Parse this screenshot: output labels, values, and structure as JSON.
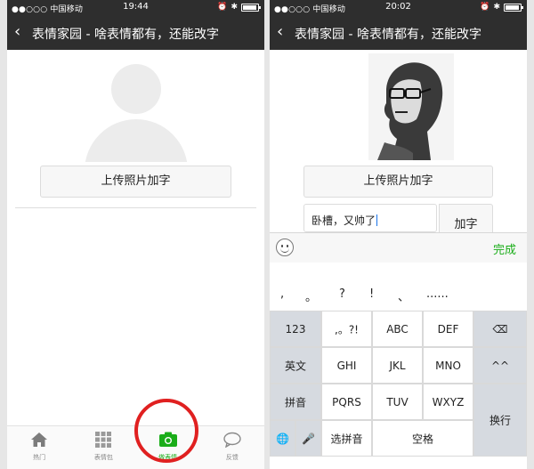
{
  "left_phone": {
    "status": {
      "carrier": "●●○○○ 中国移动",
      "time": "19:44"
    },
    "nav": {
      "back": "‹",
      "title": "表情家园 - 啥表情都有，还能改字"
    },
    "upload_button": "上传照片加字",
    "tabs": [
      {
        "label": "热门",
        "icon": "home-icon"
      },
      {
        "label": "表情包",
        "icon": "grid-icon"
      },
      {
        "label": "做表情",
        "icon": "camera-icon",
        "active": true
      },
      {
        "label": "反馈",
        "icon": "chat-bubble-icon"
      }
    ],
    "colors": {
      "nav_bg": "#2e2e2e",
      "accent": "#1aad19",
      "highlight": "#e02020"
    }
  },
  "right_phone": {
    "status": {
      "carrier": "●●○○○ 中国移动",
      "time": "20:02"
    },
    "nav": {
      "back": "‹",
      "title": "表情家园 - 啥表情都有，还能改字"
    },
    "upload_button": "上传照片加字",
    "text_input_value": "卧槽，又帅了",
    "add_text_button": "加字",
    "keyboard_toolbar": {
      "done": "完成"
    },
    "keyboard": {
      "punctuation": [
        ",",
        "。",
        "?",
        "!",
        "、",
        "......"
      ],
      "rows": [
        [
          "123",
          ",。?!",
          "ABC",
          "DEF",
          "⌫"
        ],
        [
          "英文",
          "GHI",
          "JKL",
          "MNO",
          "^^"
        ],
        [
          "拼音",
          "PQRS",
          "TUV",
          "WXYZ",
          "换行"
        ],
        [
          "🌐",
          "🎤",
          "选拼音",
          "空格"
        ]
      ]
    }
  }
}
